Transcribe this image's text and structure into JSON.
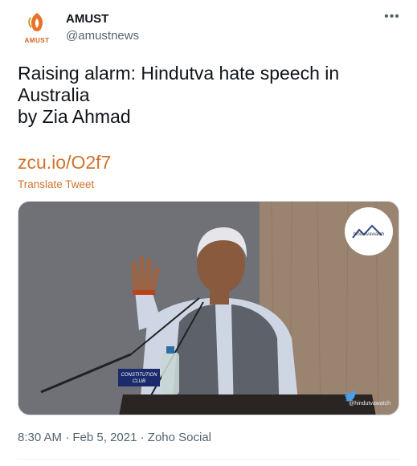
{
  "account": {
    "display_name": "AMUST",
    "handle": "@amustnews",
    "avatar_text": "AMUST",
    "avatar_icon": "amust-logo-icon",
    "more_icon": "more-dots-icon",
    "more_label": "•••"
  },
  "tweet": {
    "text_lines": [
      "Raising alarm: Hindutva hate speech in",
      "Australia",
      "by Zia Ahmad"
    ],
    "link_text": "zcu.io/O2f7",
    "translate_label": "Translate Tweet"
  },
  "media": {
    "logo_text": "hindutvawatch",
    "podium_sign_line1": "CONSTITUTION",
    "podium_sign_line2": "CLUB",
    "watermark_text": "@hindutvawatch"
  },
  "meta": {
    "time": "8:30 AM",
    "separator": "·",
    "date": "Feb 5, 2021",
    "source": "Zoho Social"
  },
  "colors": {
    "link": "#d2732c",
    "text": "#0f1419",
    "muted": "#536471"
  }
}
